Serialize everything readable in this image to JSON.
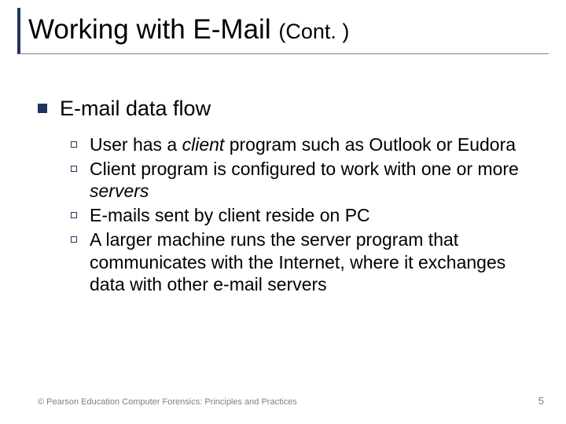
{
  "title": {
    "main": "Working with E-Mail ",
    "cont": "(Cont. )"
  },
  "heading": "E-mail data flow",
  "items": [
    {
      "pre": "User has a ",
      "em": "client",
      "post": " program such as Outlook or Eudora"
    },
    {
      "pre": "Client program is configured to work with one or more ",
      "em": "servers",
      "post": ""
    },
    {
      "pre": "E-mails sent by client reside on PC",
      "em": "",
      "post": ""
    },
    {
      "pre": "A larger machine runs the server program that communicates with the Internet, where it exchanges data with other e-mail servers",
      "em": "",
      "post": ""
    }
  ],
  "footer": {
    "copyright": "© Pearson Education  Computer Forensics: Principles and Practices",
    "page": "5"
  }
}
